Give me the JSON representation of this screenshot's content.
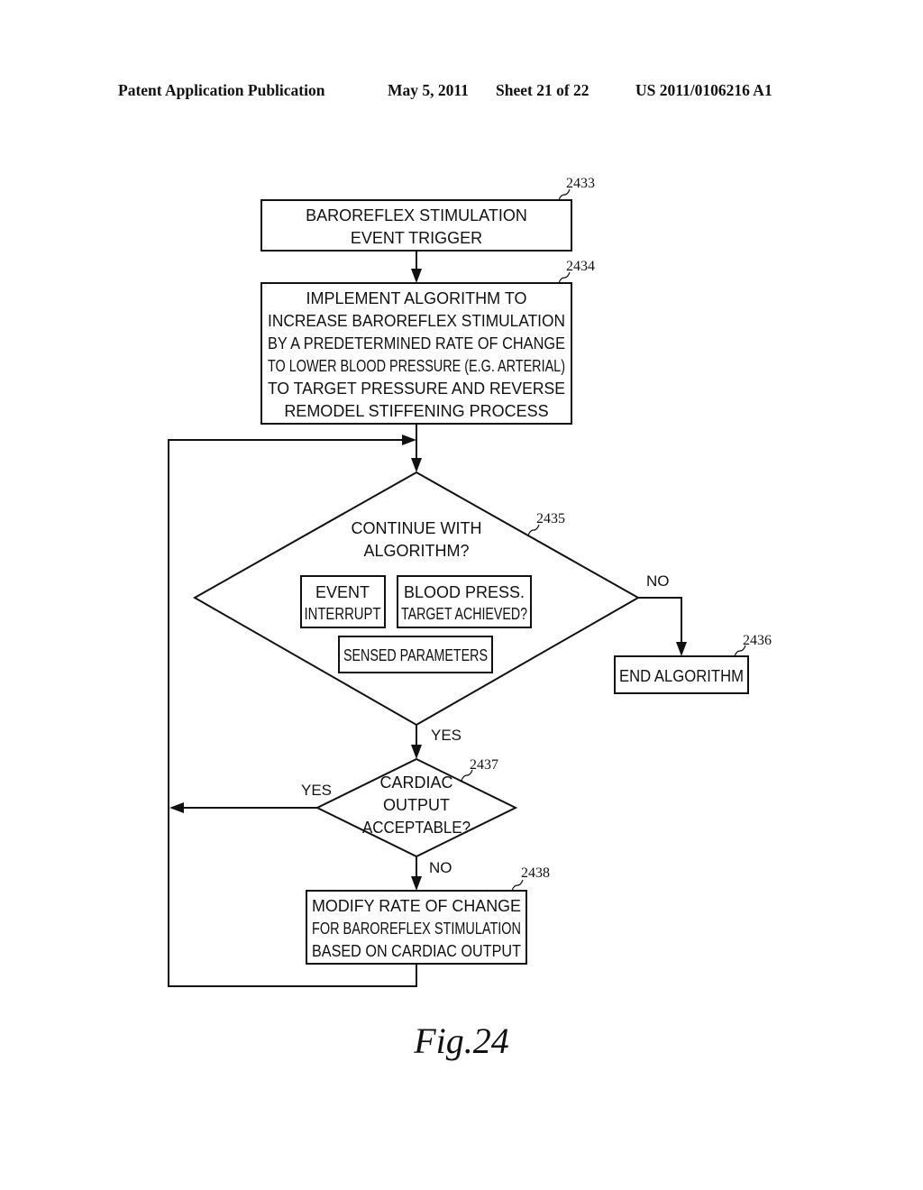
{
  "header": {
    "publication": "Patent Application Publication",
    "date": "May 5, 2011",
    "sheet": "Sheet 21 of 22",
    "number": "US 2011/0106216 A1"
  },
  "nodes": {
    "n2433": {
      "ref": "2433",
      "lines": [
        "BAROREFLEX STIMULATION",
        "EVENT TRIGGER"
      ]
    },
    "n2434": {
      "ref": "2434",
      "lines": [
        "IMPLEMENT ALGORITHM TO",
        "INCREASE BAROREFLEX STIMULATION",
        "BY A PREDETERMINED RATE OF CHANGE",
        "TO LOWER BLOOD PRESSURE (E.G. ARTERIAL)",
        "TO TARGET PRESSURE AND REVERSE",
        "REMODEL STIFFENING PROCESS"
      ]
    },
    "n2435": {
      "ref": "2435",
      "lines": [
        "CONTINUE WITH",
        "ALGORITHM?"
      ],
      "sub_event": [
        "EVENT",
        "INTERRUPT"
      ],
      "sub_bp": [
        "BLOOD PRESS.",
        "TARGET ACHIEVED?"
      ],
      "sub_sensed": "SENSED PARAMETERS"
    },
    "n2436": {
      "ref": "2436",
      "lines": [
        "END ALGORITHM"
      ]
    },
    "n2437": {
      "ref": "2437",
      "lines": [
        "CARDIAC",
        "OUTPUT",
        "ACCEPTABLE?"
      ]
    },
    "n2438": {
      "ref": "2438",
      "lines": [
        "MODIFY RATE OF CHANGE",
        "FOR BAROREFLEX STIMULATION",
        "BASED ON CARDIAC OUTPUT"
      ]
    }
  },
  "edge_labels": {
    "no_2435": "NO",
    "yes_2435": "YES",
    "yes_2437": "YES",
    "no_2437": "NO"
  },
  "figure_label": "Fig.24"
}
